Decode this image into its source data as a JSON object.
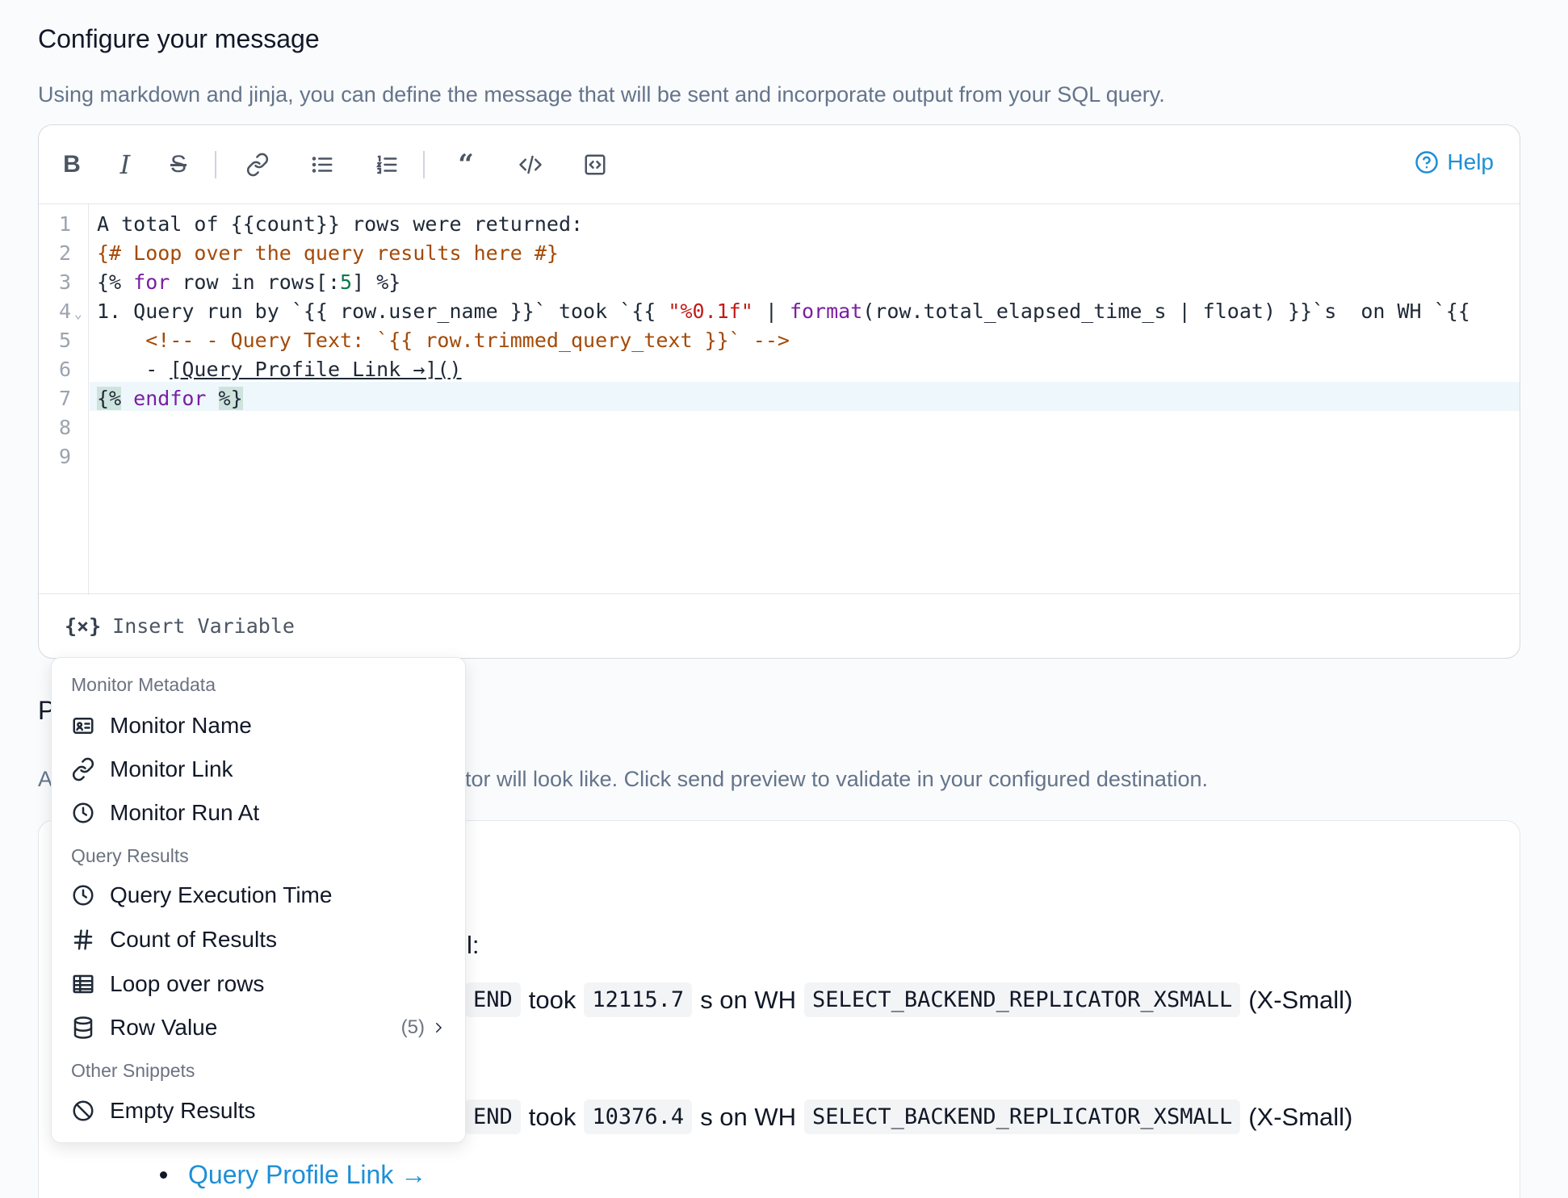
{
  "header": {
    "title": "Configure your message",
    "subtitle": "Using markdown and jinja, you can define the message that will be sent and incorporate output from your SQL query."
  },
  "toolbar": {
    "bold": "B",
    "italic": "I",
    "strike": "S",
    "help_label": "Help"
  },
  "editor": {
    "line_numbers": [
      "1",
      "2",
      "3",
      "4",
      "5",
      "6",
      "7",
      "8",
      "9"
    ],
    "lines": {
      "l1": "A total of {{count}} rows were returned:",
      "l2": "{# Loop over the query results here #}",
      "l3_a": "{% ",
      "l3_kw": "for",
      "l3_b": " row in rows[:",
      "l3_num": "5",
      "l3_c": "] %}",
      "l4_a": "1. Query run by `{{ row.user_name }}` took `{{ ",
      "l4_str": "\"%0.1f\"",
      "l4_b": " | ",
      "l4_kw": "format",
      "l4_c": "(row.total_elapsed_time_s | float) }}`s  on WH `{{",
      "l5": "    <!-- - Query Text: `{{ row.trimmed_query_text }}` -->",
      "l6_a": "    - ",
      "l6_link": "[Query Profile Link →]()",
      "l7_a": "{%",
      "l7_kw": " endfor ",
      "l7_b": "%}"
    },
    "insert_icon": "{×}",
    "insert_label": "Insert Variable"
  },
  "preview": {
    "title_fragment": "P",
    "subtitle_prefix": "A",
    "subtitle_visible": "nitor will look like. Click send preview to validate in your configured destination.",
    "returned_fragment": "l:",
    "row1": {
      "user_suffix": "END",
      "took": "took",
      "time": "12115.7",
      "on_wh": "s on WH",
      "warehouse": "SELECT_BACKEND_REPLICATOR_XSMALL",
      "size": "(X-Small)"
    },
    "row2": {
      "user_suffix": "END",
      "took": "took",
      "time": "10376.4",
      "on_wh": "s on WH",
      "warehouse": "SELECT_BACKEND_REPLICATOR_XSMALL",
      "size": "(X-Small)"
    },
    "link_label": "Query Profile Link →"
  },
  "menu": {
    "groups": {
      "metadata": "Monitor Metadata",
      "results": "Query Results",
      "other": "Other Snippets"
    },
    "items": {
      "monitor_name": "Monitor Name",
      "monitor_link": "Monitor Link",
      "monitor_run_at": "Monitor Run At",
      "exec_time": "Query Execution Time",
      "count_results": "Count of Results",
      "loop_rows": "Loop over rows",
      "row_value": "Row Value",
      "row_value_count": "(5)",
      "empty_results": "Empty Results"
    }
  },
  "colors": {
    "accent": "#1d8fd6",
    "comment": "#a44a08",
    "keyword": "#7a1fa2",
    "string": "#c41a16",
    "number": "#0a7b4b",
    "active_line": "#eef7fb"
  }
}
